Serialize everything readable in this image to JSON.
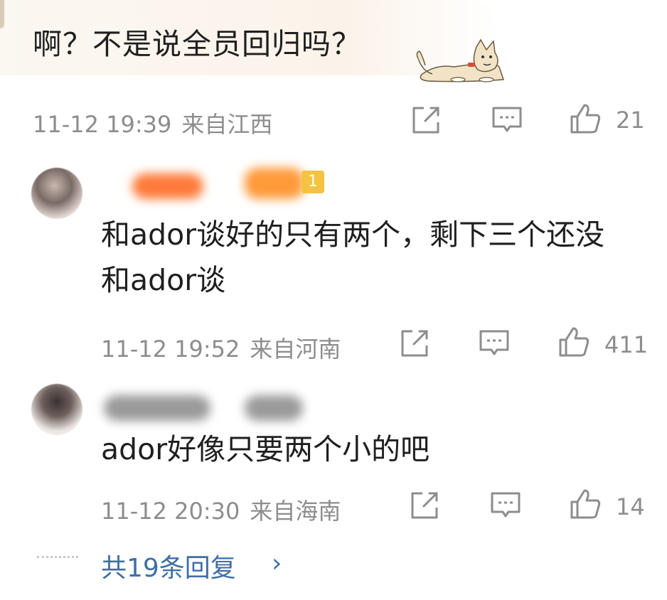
{
  "top_comment": {
    "text": "啊？不是说全员回归吗？",
    "time": "11-12 19:39",
    "location": "来自江西",
    "likes": "21",
    "sticker": "shiba-dog-sticker"
  },
  "replies": [
    {
      "text": "和ador谈好的只有两个，剩下三个还没和ador谈",
      "time": "11-12 19:52",
      "location": "来自河南",
      "likes": "411",
      "badge": "1"
    },
    {
      "text": "ador好像只要两个小的吧",
      "time": "11-12 20:30",
      "location": "来自海南",
      "likes": "14"
    }
  ],
  "more_replies": "共19条回复",
  "icons": [
    "share-icon",
    "comment-icon",
    "like-icon",
    "chevron-right-icon"
  ],
  "colors": {
    "meta": "#8d8d8d",
    "link": "#3f6fa5",
    "badge": "#f5c342"
  }
}
